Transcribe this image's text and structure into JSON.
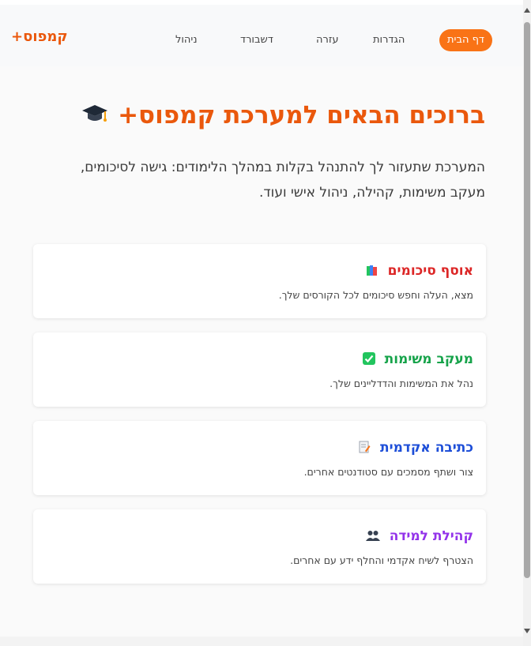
{
  "navbar": {
    "brand": "קמפוס+",
    "items": [
      {
        "label": "דף הבית",
        "active": true
      },
      {
        "label": "הגדרות",
        "active": false
      },
      {
        "label": "עזרה",
        "active": false
      },
      {
        "label": "דשבורד",
        "active": false
      },
      {
        "label": "ניהול",
        "active": false
      }
    ]
  },
  "hero": {
    "title": "ברוכים הבאים למערכת קמפוס+",
    "title_icon": "graduation-cap-icon",
    "description": "המערכת שתעזור לך להתנהל בקלות במהלך הלימודים: גישה לסיכומים, מעקב משימות, קהילה, ניהול אישי ועוד."
  },
  "cards": [
    {
      "title": "אוסף סיכומים",
      "icon": "books-icon",
      "color": "#dc2626",
      "description": "מצא, העלה וחפש סיכומים לכל הקורסים שלך."
    },
    {
      "title": "מעקב משימות",
      "icon": "check-box-icon",
      "color": "#16a34a",
      "description": "נהל את המשימות והדדליינים שלך."
    },
    {
      "title": "כתיבה אקדמית",
      "icon": "memo-icon",
      "color": "#1d4ed8",
      "description": "צור ושתף מסמכים עם סטודנטים אחרים."
    },
    {
      "title": "קהילת למידה",
      "icon": "people-icon",
      "color": "#9333ea",
      "description": "הצטרף לשיח אקדמי והחלף ידע עם אחרים."
    }
  ],
  "colors": {
    "accent": "#f97316",
    "brand": "#ea580c"
  }
}
